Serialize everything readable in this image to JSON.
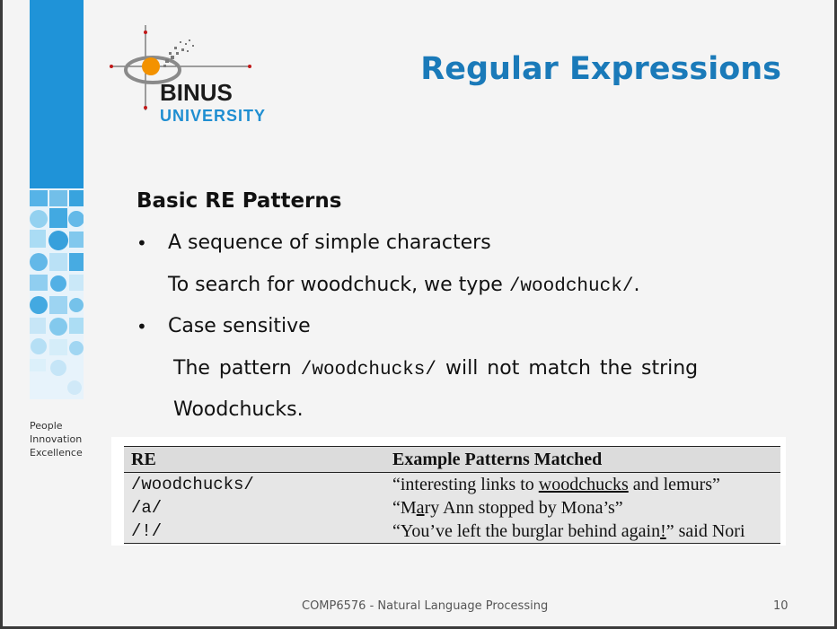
{
  "slide": {
    "title": "Regular Expressions",
    "logo": {
      "word1": "BINUS",
      "word2": "UNIVERSITY"
    },
    "tagline": [
      "People",
      "Innovation",
      "Excellence"
    ],
    "heading": "Basic RE Patterns",
    "bullets": [
      {
        "text": "A sequence of simple characters",
        "detail_prefix": "To search for woodchuck, we type ",
        "detail_code": "/woodchuck/",
        "detail_suffix": "."
      },
      {
        "text": "Case sensitive",
        "detail_prefix": "The pattern ",
        "detail_code": "/woodchucks/",
        "detail_suffix": " will not match the string",
        "detail_line2": "Woodchucks."
      }
    ],
    "table": {
      "headers": [
        "RE",
        "Example Patterns Matched"
      ],
      "rows": [
        {
          "re": "/woodchucks/",
          "pre": "“interesting links to ",
          "match": "woodchucks",
          "post": " and lemurs”"
        },
        {
          "re": "/a/",
          "pre": "“M",
          "match": "a",
          "post": "ry Ann stopped by Mona’s”"
        },
        {
          "re": "/!/",
          "pre": "“You’ve left the burglar behind again",
          "match": "!",
          "post": "” said Nori"
        }
      ]
    },
    "footer": {
      "course": "COMP6576 - Natural Language Processing",
      "page": "10"
    },
    "colors": {
      "title": "#1a7ab9",
      "stripe": "#1e90d6",
      "logo_orange": "#f39200",
      "background": "#f4f4f4"
    }
  }
}
